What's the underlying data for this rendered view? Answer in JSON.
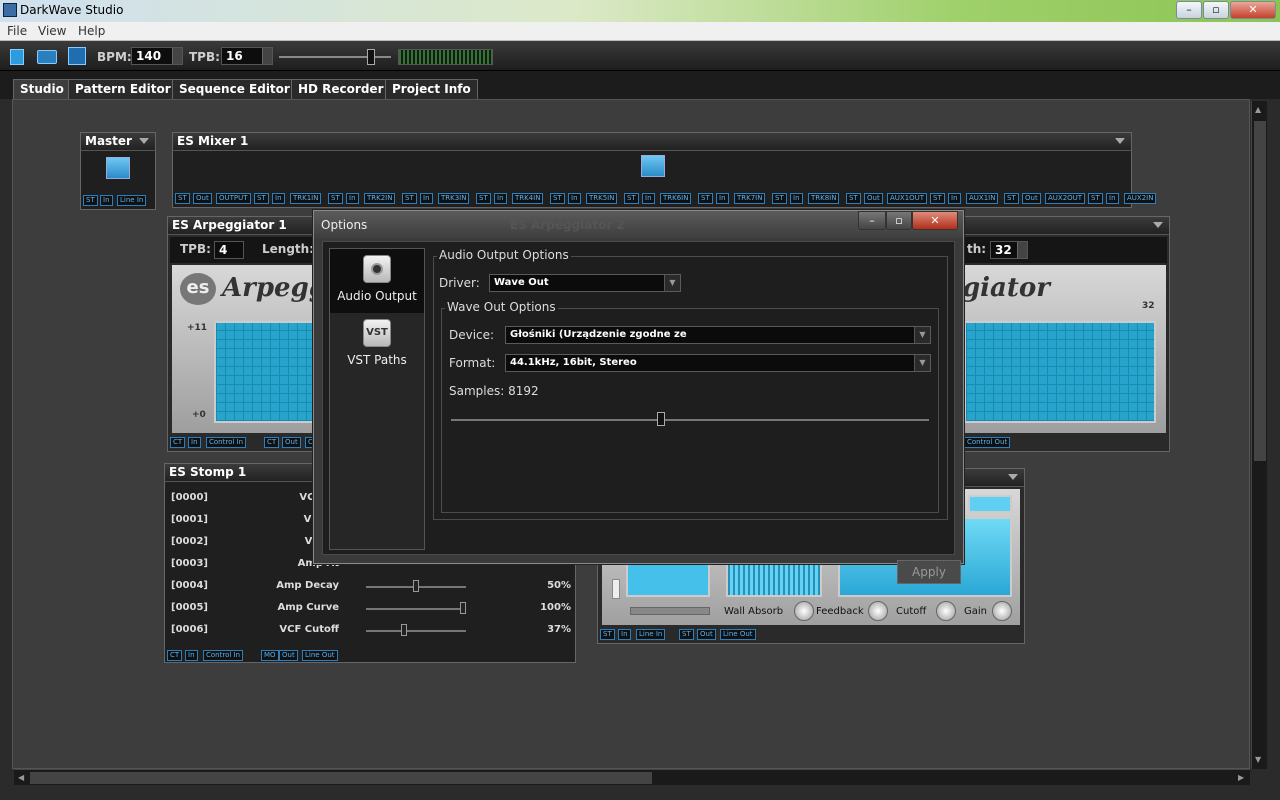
{
  "window": {
    "title": "DarkWave Studio"
  },
  "menu": [
    "File",
    "View",
    "Help"
  ],
  "toolbar": {
    "bpm_label": "BPM:",
    "bpm_value": "140",
    "tpb_label": "TPB:",
    "tpb_value": "16"
  },
  "tabs": [
    "Studio",
    "Pattern Editor",
    "Sequence Editor",
    "HD Recorder",
    "Project Info"
  ],
  "master": {
    "title": "Master",
    "ports": [
      "ST",
      "In",
      "Line In"
    ]
  },
  "mixer": {
    "title": "ES Mixer 1",
    "ports": [
      "ST",
      "Out",
      "OUTPUT",
      "ST",
      "In",
      "TRK1IN",
      "ST",
      "In",
      "TRK2IN",
      "ST",
      "In",
      "TRK3IN",
      "ST",
      "In",
      "TRK4IN",
      "ST",
      "In",
      "TRK5IN",
      "ST",
      "In",
      "TRK6IN",
      "ST",
      "In",
      "TRK7IN",
      "ST",
      "In",
      "TRK8IN",
      "ST",
      "Out",
      "AUX1OUT",
      "ST",
      "In",
      "AUX1IN",
      "ST",
      "Out",
      "AUX2OUT",
      "ST",
      "In",
      "AUX2IN"
    ]
  },
  "arpeggiator": {
    "title": "ES Arpeggiator 1",
    "tpb_label": "TPB:",
    "tpb_value": "4",
    "length_label": "Length:",
    "length2_label": "th:",
    "length2_value": "32",
    "logo_left": "Arpeggi",
    "logo_right": "giator",
    "logo_badge": "es",
    "axis_top": "+11",
    "axis_bottom": "+0",
    "right_num": "32",
    "ports_left": [
      "CT",
      "In",
      "Control In",
      "CT",
      "Out",
      "Contro"
    ],
    "ports_right": [
      "Control Out"
    ],
    "ghost_title": "ES Arpeggiator 2"
  },
  "stomp": {
    "title": "ES Stomp 1",
    "rows": [
      {
        "idx": "[0000]",
        "name": "VCO At",
        "value": ""
      },
      {
        "idx": "[0001]",
        "name": "VCO D",
        "value": ""
      },
      {
        "idx": "[0002]",
        "name": "VCO C",
        "value": ""
      },
      {
        "idx": "[0003]",
        "name": "Amp At",
        "value": ""
      },
      {
        "idx": "[0004]",
        "name": "Amp Decay",
        "value": "50%",
        "level": 0.5
      },
      {
        "idx": "[0005]",
        "name": "Amp Curve",
        "value": "100%",
        "level": 1.0
      },
      {
        "idx": "[0006]",
        "name": "VCF Cutoff",
        "value": "37%",
        "level": 0.37
      }
    ],
    "ports": [
      "CT",
      "In",
      "Control In",
      "MO",
      "Out",
      "Line Out"
    ]
  },
  "reverb": {
    "knobs": [
      "Wall Absorb",
      "Feedback",
      "Cutoff",
      "Gain"
    ],
    "ports": [
      "ST",
      "In",
      "Line In",
      "ST",
      "Out",
      "Line Out"
    ]
  },
  "dialog": {
    "title": "Options",
    "sidebar": [
      {
        "label": "Audio Output",
        "icon": "speaker-icon"
      },
      {
        "label": "VST Paths",
        "icon": "vst-icon",
        "icon_text": "VST"
      }
    ],
    "group_title": "Audio Output Options",
    "driver_label": "Driver:",
    "driver_value": "Wave Out",
    "sub_group_title": "Wave Out Options",
    "device_label": "Device:",
    "device_value": "Głośniki (Urządzenie zgodne ze",
    "format_label": "Format:",
    "format_value": "44.1kHz, 16bit, Stereo",
    "samples_label": "Samples: 8192",
    "samples_level": 0.43,
    "apply_label": "Apply"
  }
}
